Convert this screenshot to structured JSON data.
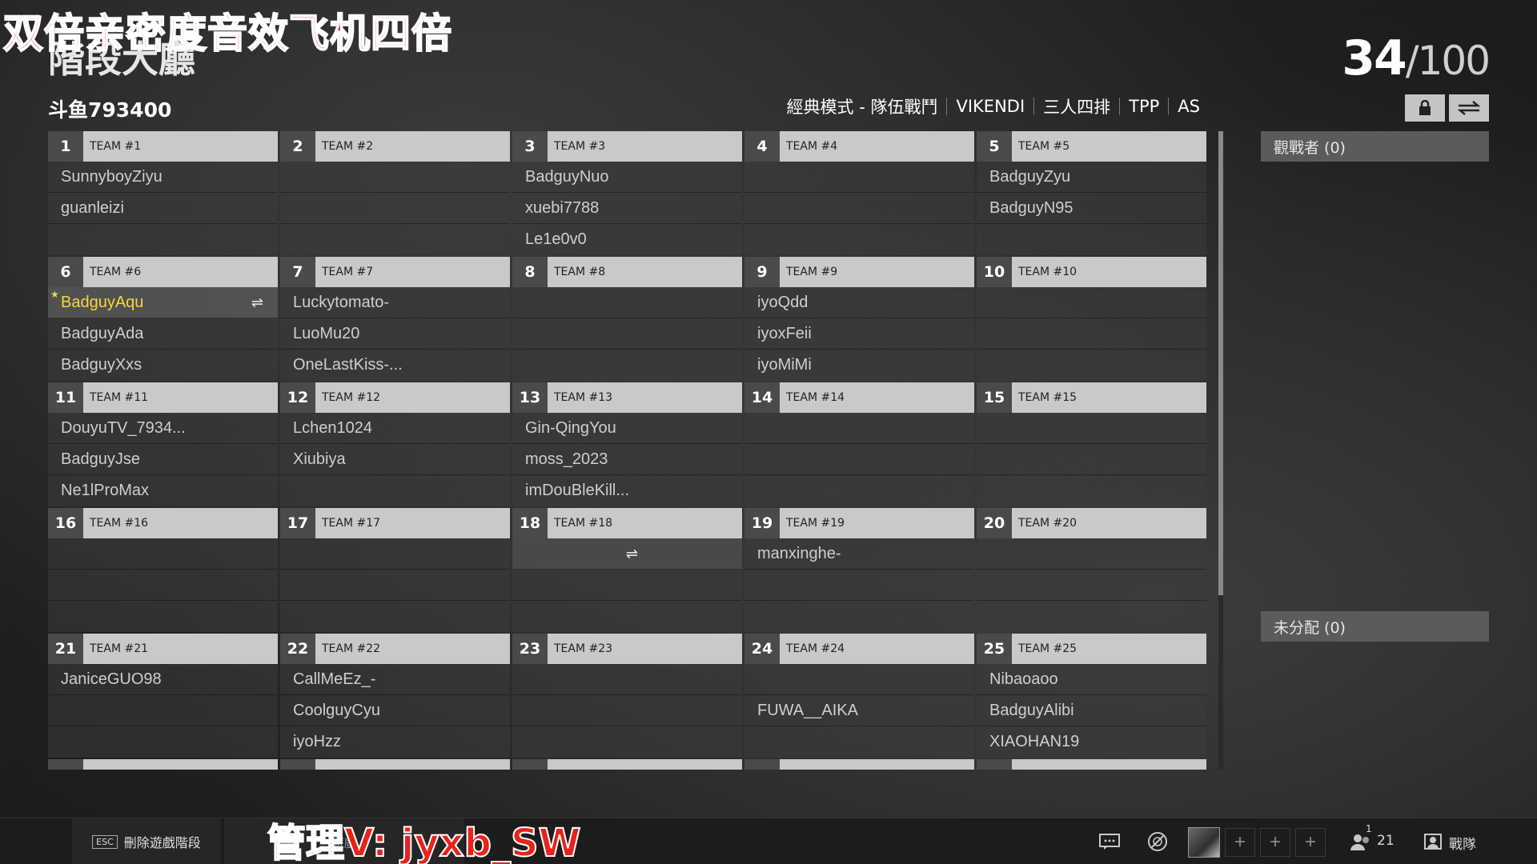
{
  "overlay_top_text": "双倍亲密度音效飞机四倍",
  "overlay_bottom_text": "管理V: jyxb_SW",
  "page_title": "階段大廳",
  "counter": {
    "current": "34",
    "max": "/100"
  },
  "host_label": "斗鱼793400",
  "mode_bar": [
    "經典模式 - 隊伍戰鬥",
    "VIKENDI",
    "三人四排",
    "TPP",
    "AS"
  ],
  "side_panels": {
    "spectators": "觀戰者 (0)",
    "unassigned": "未分配 (0)"
  },
  "teams": [
    {
      "num": "1",
      "name": "TEAM #1",
      "players": [
        "SunnyboyZiyu",
        "guanleizi",
        ""
      ]
    },
    {
      "num": "2",
      "name": "TEAM #2",
      "players": [
        "",
        "",
        ""
      ]
    },
    {
      "num": "3",
      "name": "TEAM #3",
      "players": [
        "BadguyNuo",
        "xuebi7788",
        "Le1e0v0"
      ]
    },
    {
      "num": "4",
      "name": "TEAM #4",
      "players": [
        "",
        "",
        ""
      ]
    },
    {
      "num": "5",
      "name": "TEAM #5",
      "players": [
        "BadguyZyu",
        "BadguyN95",
        ""
      ]
    },
    {
      "num": "6",
      "name": "TEAM #6",
      "players": [
        "BadguyAqu",
        "BadguyAda",
        "BadguyXxs"
      ]
    },
    {
      "num": "7",
      "name": "TEAM #7",
      "players": [
        "Luckytomato-",
        "LuoMu20",
        "OneLastKiss-..."
      ]
    },
    {
      "num": "8",
      "name": "TEAM #8",
      "players": [
        "",
        "",
        ""
      ]
    },
    {
      "num": "9",
      "name": "TEAM #9",
      "players": [
        "iyoQdd",
        "iyoxFeii",
        "iyoMiMi"
      ]
    },
    {
      "num": "10",
      "name": "TEAM #10",
      "players": [
        "",
        "",
        ""
      ]
    },
    {
      "num": "11",
      "name": "TEAM #11",
      "players": [
        "DouyuTV_7934...",
        "BadguyJse",
        "Ne1lProMax"
      ]
    },
    {
      "num": "12",
      "name": "TEAM #12",
      "players": [
        "Lchen1024",
        "Xiubiya",
        ""
      ]
    },
    {
      "num": "13",
      "name": "TEAM #13",
      "players": [
        "Gin-QingYou",
        "moss_2023",
        "imDouBleKill..."
      ]
    },
    {
      "num": "14",
      "name": "TEAM #14",
      "players": [
        "",
        "",
        ""
      ]
    },
    {
      "num": "15",
      "name": "TEAM #15",
      "players": [
        "",
        "",
        ""
      ]
    },
    {
      "num": "16",
      "name": "TEAM #16",
      "players": [
        "",
        "",
        ""
      ]
    },
    {
      "num": "17",
      "name": "TEAM #17",
      "players": [
        "",
        "",
        ""
      ]
    },
    {
      "num": "18",
      "name": "TEAM #18",
      "players": [
        "",
        "",
        ""
      ]
    },
    {
      "num": "19",
      "name": "TEAM #19",
      "players": [
        "manxinghe-",
        "",
        ""
      ]
    },
    {
      "num": "20",
      "name": "TEAM #20",
      "players": [
        "",
        "",
        ""
      ]
    },
    {
      "num": "21",
      "name": "TEAM #21",
      "players": [
        "JaniceGUO98",
        "",
        ""
      ]
    },
    {
      "num": "22",
      "name": "TEAM #22",
      "players": [
        "CallMeEz_-",
        "CoolguyCyu",
        "iyoHzz"
      ]
    },
    {
      "num": "23",
      "name": "TEAM #23",
      "players": [
        "",
        "",
        ""
      ]
    },
    {
      "num": "24",
      "name": "TEAM #24",
      "players": [
        "",
        "FUWA__AIKA",
        ""
      ]
    },
    {
      "num": "25",
      "name": "TEAM #25",
      "players": [
        "Nibaoaoo",
        "BadguyAlibi",
        "XIAOHAN19"
      ]
    }
  ],
  "bottom_bar": {
    "esc_key": "ESC",
    "delete_label": "刪除遊戲階段",
    "dim_label": "遊戲",
    "friends_count": "21",
    "friends_badge": "1",
    "battle_label": "戰隊"
  },
  "icons": [
    "lock-icon",
    "swap-icon",
    "chat-icon",
    "settings-icon",
    "friends-icon",
    "clan-icon"
  ],
  "colors": {
    "highlight_player": "#f4d83b",
    "overlay_red": "#e8231c"
  }
}
